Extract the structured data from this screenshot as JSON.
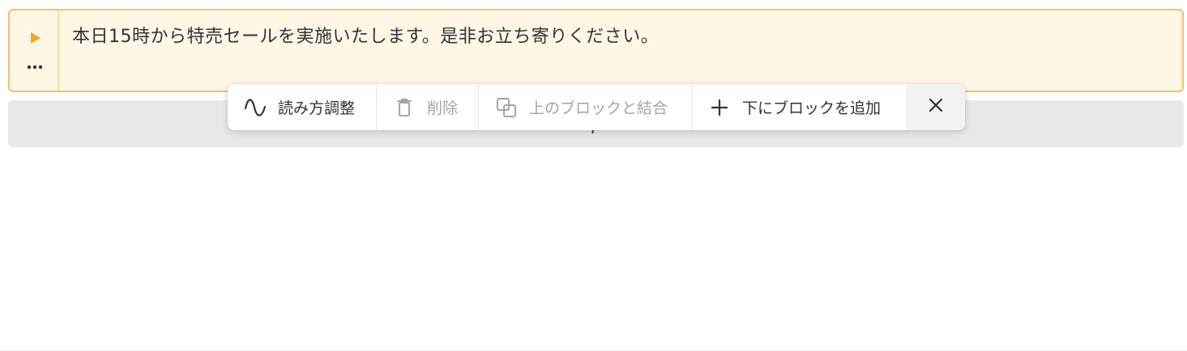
{
  "block": {
    "text": "本日15時から特売セールを実施いたします。是非お立ち寄りください。",
    "accent_color": "#f5a623",
    "border_color": "#f5c06a",
    "background_color": "#fff6e6",
    "play_icon": "play-triangle",
    "more_icon": "horizontal-ellipsis"
  },
  "toolbar": {
    "reading_adjust": {
      "label": "読み方調整",
      "icon": "wave-icon",
      "enabled": true
    },
    "delete": {
      "label": "削除",
      "icon": "trash-icon",
      "enabled": false
    },
    "merge_above": {
      "label": "上のブロックと結合",
      "icon": "merge-icon",
      "enabled": false
    },
    "add_below": {
      "label": "下にブロックを追加",
      "icon": "plus-icon",
      "enabled": true
    },
    "close": {
      "icon": "close-icon"
    }
  },
  "colors": {
    "text": "#333333",
    "disabled_text": "#a5a5a5",
    "next_block_bg": "#e8e8e8"
  }
}
